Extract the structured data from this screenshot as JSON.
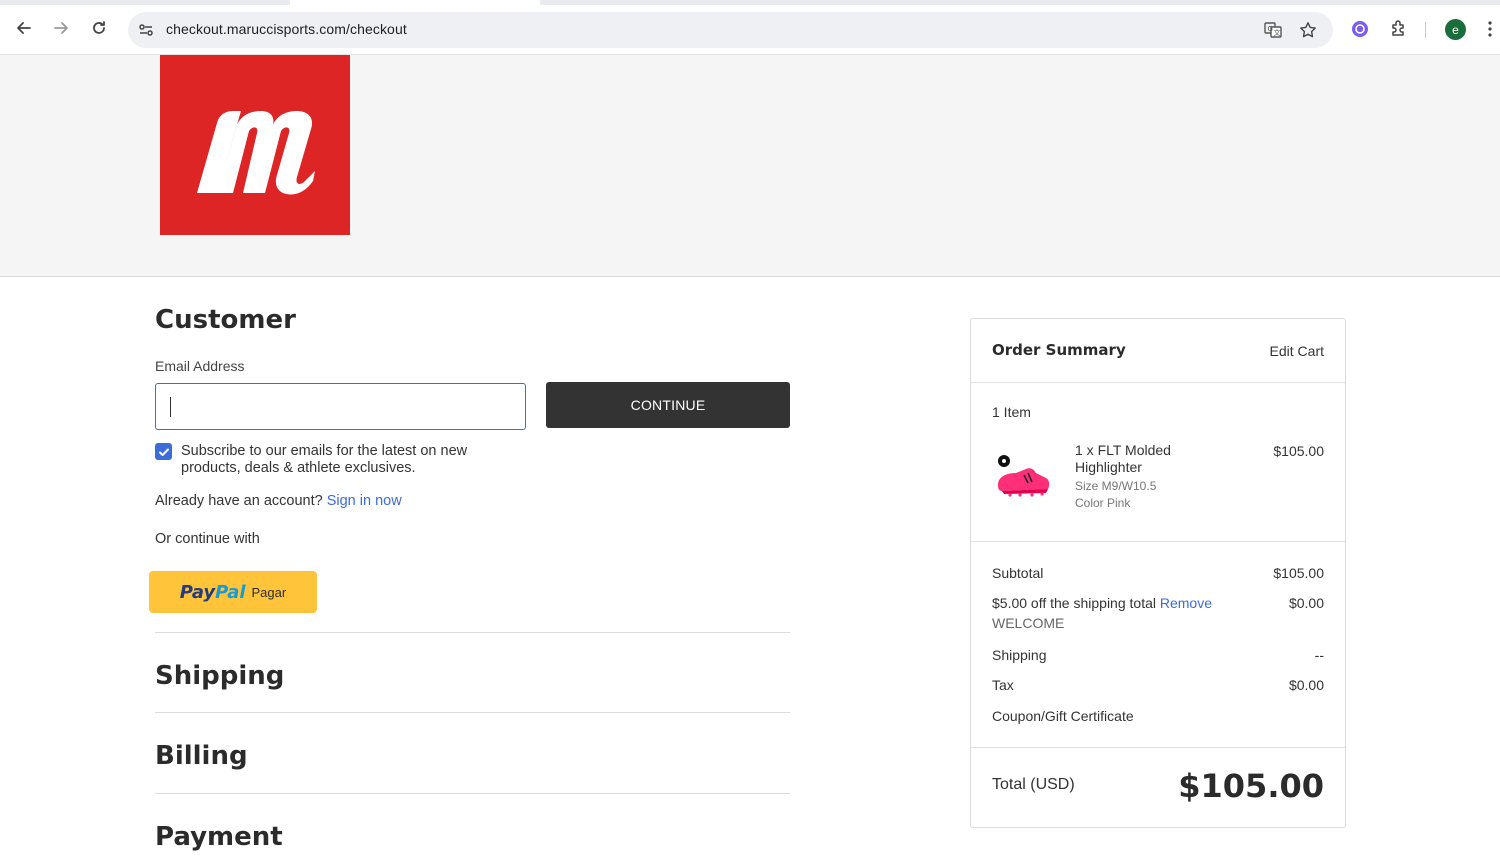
{
  "browser": {
    "url": "checkout.maruccisports.com/checkout",
    "avatar_letter": "e"
  },
  "checkout": {
    "customer_title": "Customer",
    "email_label": "Email Address",
    "email_value": "",
    "continue_label": "CONTINUE",
    "subscribe_text": "Subscribe to our emails for the latest on new products, deals & athlete exclusives.",
    "subscribe_checked": true,
    "account_prompt": "Already have an account?",
    "sign_in_link": "Sign in now",
    "or_continue": "Or continue with",
    "paypal_pay": "Pay",
    "paypal_pal": "Pal",
    "paypal_pagar": "Pagar",
    "shipping_title": "Shipping",
    "billing_title": "Billing",
    "payment_title": "Payment"
  },
  "summary": {
    "title": "Order Summary",
    "edit_cart": "Edit Cart",
    "item_count": "1 Item",
    "product_name_line1": "1 x FLT Molded",
    "product_name_line2": "Highlighter",
    "product_size": "Size M9/W10.5",
    "product_color": "Color Pink",
    "product_price": "$105.00",
    "subtotal_label": "Subtotal",
    "subtotal_value": "$105.00",
    "discount_label": "$5.00 off the shipping total",
    "discount_remove": "Remove",
    "discount_code": "WELCOME",
    "discount_value": "$0.00",
    "shipping_label": "Shipping",
    "shipping_value": "--",
    "tax_label": "Tax",
    "tax_value": "$0.00",
    "coupon_link": "Coupon/Gift Certificate",
    "total_label": "Total (USD)",
    "total_value": "$105.00"
  },
  "colors": {
    "accent": "#3c6cd8",
    "brand_red": "#dd2526",
    "paypal_yellow": "#ffc439",
    "button_dark": "#333333"
  }
}
